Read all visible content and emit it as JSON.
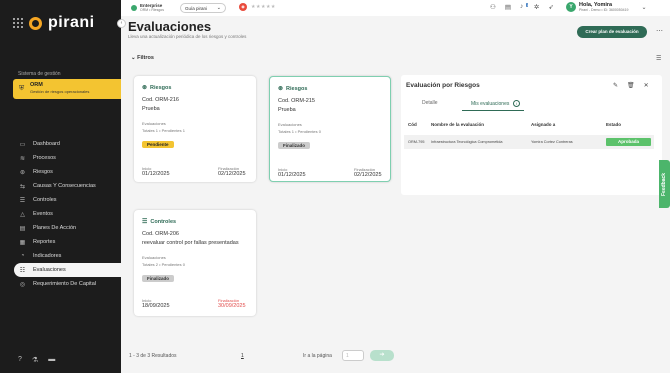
{
  "brand": {
    "logo_text": "pirani"
  },
  "sidebar": {
    "system_label": "Sistema de gestión",
    "module": {
      "title": "ORM",
      "subtitle": "Gestión de riesgos operacionales"
    },
    "items": [
      {
        "label": "Dashboard",
        "icon": "monitor-icon"
      },
      {
        "label": "Procesos",
        "icon": "layers-icon"
      },
      {
        "label": "Riesgos",
        "icon": "warning-icon"
      },
      {
        "label": "Causas Y Consecuencias",
        "icon": "cause-effect-icon"
      },
      {
        "label": "Controles",
        "icon": "sliders-icon"
      },
      {
        "label": "Eventos",
        "icon": "alert-triangle-icon"
      },
      {
        "label": "Planes De Acción",
        "icon": "clipboard-icon"
      },
      {
        "label": "Reportes",
        "icon": "report-icon"
      },
      {
        "label": "Indicadores",
        "icon": "gauge-icon"
      },
      {
        "label": "Evaluaciones",
        "icon": "list-check-icon",
        "active": true
      },
      {
        "label": "Requerimiento De Capital",
        "icon": "capital-icon"
      }
    ]
  },
  "topbar": {
    "enterprise": {
      "name": "Enterprise",
      "sub": "ORM • Riesgos"
    },
    "guide": "Guía pirani",
    "notification_count": "1",
    "user": {
      "greeting": "Hola, Yomira",
      "sub": "Pirani - Demo • ID: 3600050419",
      "initial": "Y"
    }
  },
  "page": {
    "title": "Evaluaciones",
    "subtitle": "Lleva una actualización periódica de los riesgos y controles",
    "create_button": "Crear plan de evaluación",
    "filters_label": "Filtros"
  },
  "cards": [
    {
      "type": "Riesgos",
      "code": "Cod. ORM-216",
      "desc": "Prueba",
      "evals_label": "Evaluaciones",
      "evals_meta": "Totales 1 • Pendientes 1",
      "status": "Pendiente",
      "start_label": "Inicio",
      "start": "01/12/2025",
      "end_label": "Finalización",
      "end": "02/12/2025"
    },
    {
      "type": "Riesgos",
      "code": "Cod. ORM-215",
      "desc": "Prueba",
      "evals_label": "Evaluaciones",
      "evals_meta": "Totales 1 • Pendientes 0",
      "status": "Finalizado",
      "start_label": "Inicio",
      "start": "01/12/2025",
      "end_label": "Finalización",
      "end": "02/12/2025"
    },
    {
      "type": "Controles",
      "code": "Cod. ORM-206",
      "desc": "reevaluar control por fallas presentadas",
      "evals_label": "Evaluaciones",
      "evals_meta": "Totales 2 • Pendientes 0",
      "status": "Finalizado",
      "start_label": "Inicio",
      "start": "18/09/2025",
      "end_label": "Finalización",
      "end": "30/09/2025"
    }
  ],
  "panel": {
    "title": "Evaluación por Riesgos",
    "tabs": [
      "Detalle",
      "Mis evaluaciones"
    ],
    "columns": [
      "Cód",
      "Nombre de la evaluación",
      "Asignado a",
      "Estado"
    ],
    "row": {
      "code": "ORM-795",
      "name": "Infraestructura Tecnológica Comprometida",
      "assigned": "Yomira Cortez Contreras",
      "status": "Aprobada"
    }
  },
  "pagination": {
    "results": "1 - 3 de 3 Resultados",
    "page": "1",
    "goto_label": "Ir a la página",
    "goto_placeholder": "1"
  },
  "feedback": "Feedback",
  "colors": {
    "accent": "#2f6b56",
    "warning": "#f3c431",
    "success": "#5cc26b",
    "danger": "#e24c4b"
  }
}
